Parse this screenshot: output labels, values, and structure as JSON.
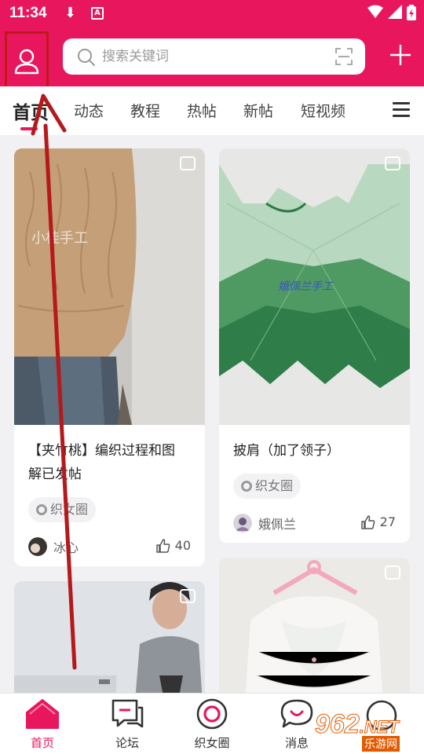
{
  "status_bar": {
    "time": "11:34",
    "a_badge": "A"
  },
  "header": {
    "search": {
      "placeholder": "搜索关键词"
    },
    "colors": {
      "brand": "#e8175d"
    }
  },
  "tabs": [
    {
      "label": "首页",
      "active": true
    },
    {
      "label": "动态"
    },
    {
      "label": "教程"
    },
    {
      "label": "热帖"
    },
    {
      "label": "新帖"
    },
    {
      "label": "短视频"
    }
  ],
  "cards": [
    {
      "title": "【夹竹桃】编织过程和图解已发帖",
      "title_line1": "【夹竹桃】编织过程和图",
      "title_line2": "解已发帖",
      "image_caption": "小桂手工",
      "tag": "织女圈",
      "user": "冰心",
      "likes": "40"
    },
    {
      "title": "披肩（加了领子）",
      "image_caption": "娥佩兰手工",
      "tag": "织女圈",
      "user": "娥佩兰",
      "likes": "27"
    }
  ],
  "bottom_nav": [
    {
      "label": "首页",
      "icon": "home-icon",
      "active": true
    },
    {
      "label": "论坛",
      "icon": "forum-icon"
    },
    {
      "label": "织女圈",
      "icon": "circle-icon"
    },
    {
      "label": "消息",
      "icon": "message-icon"
    },
    {
      "label": "",
      "icon": "profile-icon"
    }
  ],
  "watermark": {
    "text": "962",
    "suffix": ".NET",
    "sub": "乐游网"
  }
}
